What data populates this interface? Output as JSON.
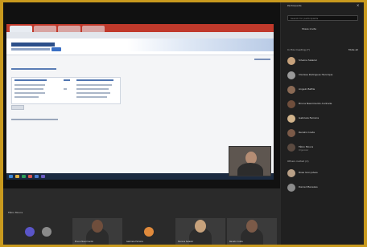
{
  "participants_panel": {
    "title": "Participants",
    "close_icon": "close-icon",
    "search_placeholder": "Search for participants",
    "share_invite_label": "Share invite",
    "in_meeting_header": "In this meeting (7)",
    "mute_all_label": "Mute all",
    "in_meeting": [
      {
        "name": "Silvana Salazar",
        "avatar_color": "#c7a27c",
        "subtitle": ""
      },
      {
        "name": "Clarissa Rodrigues Henrique",
        "avatar_color": "#9a9a9a",
        "subtitle": ""
      },
      {
        "name": "Angelo Battle",
        "avatar_color": "#8a6a55",
        "subtitle": ""
      },
      {
        "name": "Bruna Nascimento Andrade",
        "avatar_color": "#6f4e3c",
        "subtitle": ""
      },
      {
        "name": "Gabriela Ferreira",
        "avatar_color": "#d2b48c",
        "subtitle": ""
      },
      {
        "name": "Renato Costa",
        "avatar_color": "#7b5a48",
        "subtitle": ""
      },
      {
        "name": "Fábio Moura",
        "avatar_color": "#5b4a40",
        "subtitle": "Organizer"
      }
    ],
    "others_header": "Others invited (2)",
    "others": [
      {
        "name": "Rosa Gonçalves",
        "avatar_color": "#b9a087"
      },
      {
        "name": "Daniel Menezes",
        "avatar_color": "#8c8c8c"
      }
    ]
  },
  "bottom_strip": {
    "label": "Fábio Moura",
    "tiles": [
      {
        "caption": "",
        "avatar_color": "#5a55c8"
      },
      {
        "caption": "",
        "avatar_color": "#8a8a8a"
      },
      {
        "caption": "Bruna Nascimento",
        "avatar_color": "#6f4e3c"
      },
      {
        "caption": "Gabriela Ferreira",
        "avatar_color": "#e08a3c"
      },
      {
        "caption": "Silvana Salazar",
        "avatar_color": "#c7a27c"
      },
      {
        "caption": "Renato Costa",
        "avatar_color": "#7b5a48"
      }
    ]
  },
  "shared_screen": {
    "header_color": "#c0392b",
    "taskbar_color": "#1b2a40"
  }
}
